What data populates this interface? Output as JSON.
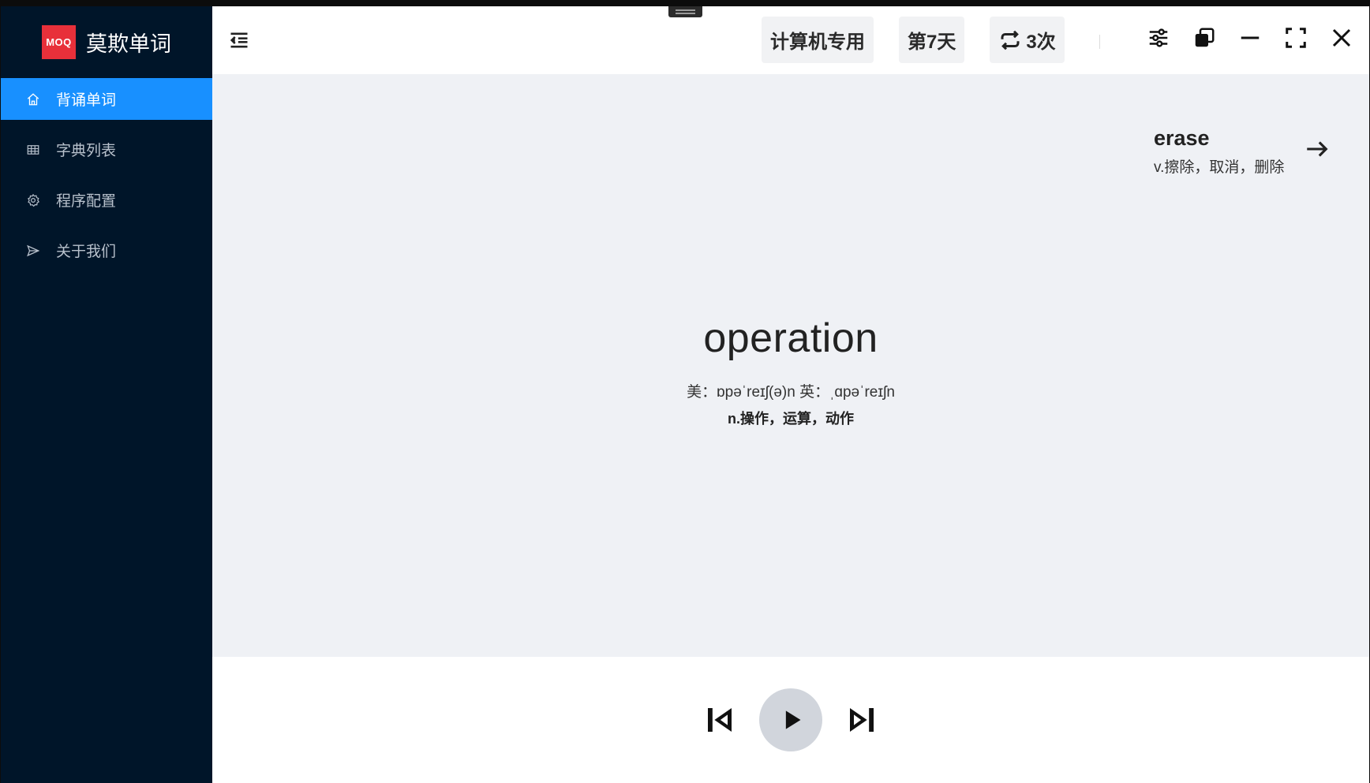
{
  "app": {
    "logo_badge": "MOQ",
    "title": "莫欺单词"
  },
  "sidebar": {
    "items": [
      {
        "label": "背诵单词",
        "icon": "home-icon",
        "active": true
      },
      {
        "label": "字典列表",
        "icon": "table-icon",
        "active": false
      },
      {
        "label": "程序配置",
        "icon": "gear-icon",
        "active": false
      },
      {
        "label": "关于我们",
        "icon": "send-icon",
        "active": false
      }
    ]
  },
  "header": {
    "dictionary": "计算机专用",
    "day": "第7天",
    "repeat": "3次",
    "actions": [
      "settings-sliders-icon",
      "copy-icon",
      "minimize-icon",
      "fullscreen-icon",
      "close-icon"
    ]
  },
  "next_word": {
    "word": "erase",
    "meaning": "v.擦除，取消，删除"
  },
  "current_word": {
    "word": "operation",
    "phonetic": "美：ɒpəˈreɪʃ(ə)n 英：ˌɑpəˈreɪʃn",
    "meaning": "n.操作，运算，动作"
  },
  "player": {
    "controls": [
      "previous-icon",
      "play-icon",
      "next-icon"
    ]
  },
  "colors": {
    "sidebar_bg": "#001529",
    "accent": "#1890ff",
    "logo_red": "#e8303a",
    "content_bg": "#eff1f5"
  }
}
